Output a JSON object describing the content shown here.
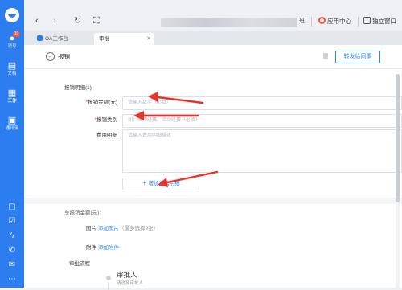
{
  "sidebar": {
    "items": [
      {
        "label": "消息",
        "icon": "chat-bubble-icon",
        "badge": "10"
      },
      {
        "label": "文档",
        "icon": "document-icon"
      },
      {
        "label": "工作",
        "icon": "grid-apps-icon"
      },
      {
        "label": "通讯录",
        "icon": "contacts-icon"
      }
    ],
    "bottom_icons": [
      "calendar-icon",
      "checklist-icon",
      "lightning-icon",
      "phone-icon",
      "mail-icon",
      "more-icon"
    ]
  },
  "topbar": {
    "tail_text": "班",
    "app_center_label": "应用中心",
    "standalone_window_label": "独立窗口"
  },
  "tabs": [
    {
      "label": "OA工作台",
      "active": false
    },
    {
      "label": "审批",
      "active": true
    }
  ],
  "header": {
    "title": "报销",
    "forward_button": "转发给同事"
  },
  "form": {
    "section_title": "报销明细(1)",
    "amount": {
      "label": "报销金额(元)",
      "required": "*",
      "placeholder": "请输入数字（必填）"
    },
    "category": {
      "label": "报销类别",
      "required": "*",
      "placeholder": "如：采购经费、活动经费（必填）"
    },
    "detail": {
      "label": "费用明细",
      "placeholder": "请输入费用明细描述"
    },
    "add_detail_button": "＋ 增加报销明细",
    "total_label": "总报销金额(元):",
    "picture": {
      "label": "图片",
      "link": "添加图片",
      "hint": "（最多选择9张）"
    },
    "attachment": {
      "label": "附件",
      "link": "添加附件"
    },
    "flow_label": "审批流程",
    "approver": {
      "name": "审批人",
      "sub": "请选择审批人"
    }
  },
  "colors": {
    "brand": "#2c7df0",
    "annotation_arrow": "#e8322a",
    "link": "#2f86ea"
  }
}
